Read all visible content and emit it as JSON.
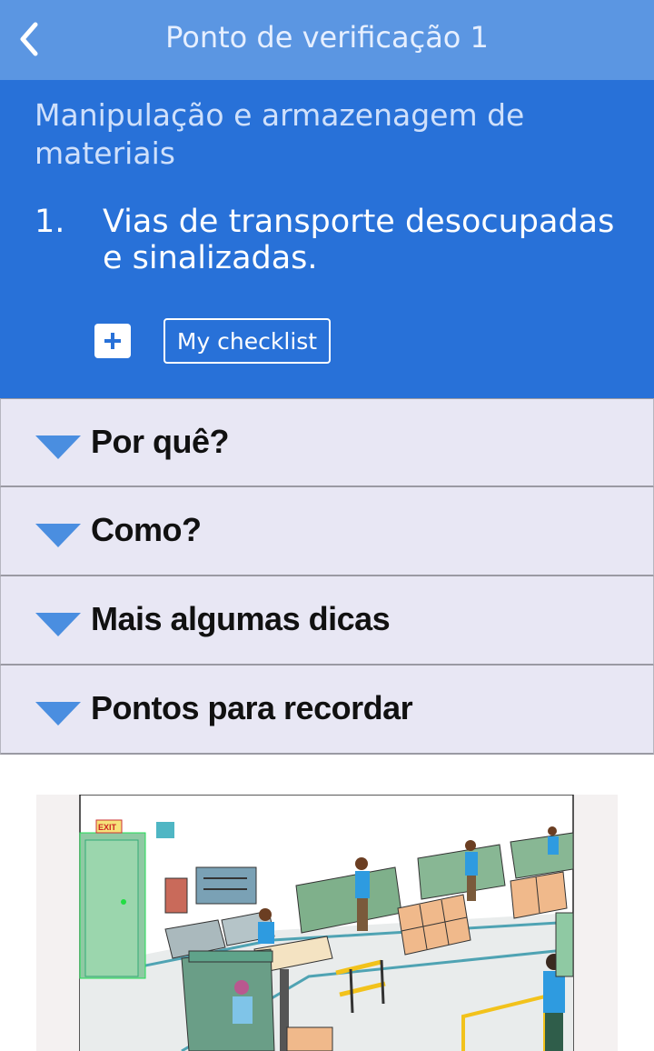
{
  "topbar": {
    "title": "Ponto de verificação 1",
    "back_icon": "chevron-left-icon"
  },
  "header": {
    "category": "Manipulação e armazenagem de materiais",
    "item_number": "1.",
    "item_text": "Vias de transporte desocupadas e sinalizadas.",
    "add_icon": "plus-icon",
    "checklist_label": "My checklist"
  },
  "sections": [
    {
      "label": "Por quê?"
    },
    {
      "label": "Como?"
    },
    {
      "label": "Mais algumas dicas"
    },
    {
      "label": "Pontos para recordar"
    }
  ],
  "illustration": {
    "exit_sign": "EXIT"
  },
  "colors": {
    "topbar": "#5b96e2",
    "header": "#2871d8",
    "accordion_bg": "#e8e7f4",
    "arrow": "#4a8ee0"
  }
}
